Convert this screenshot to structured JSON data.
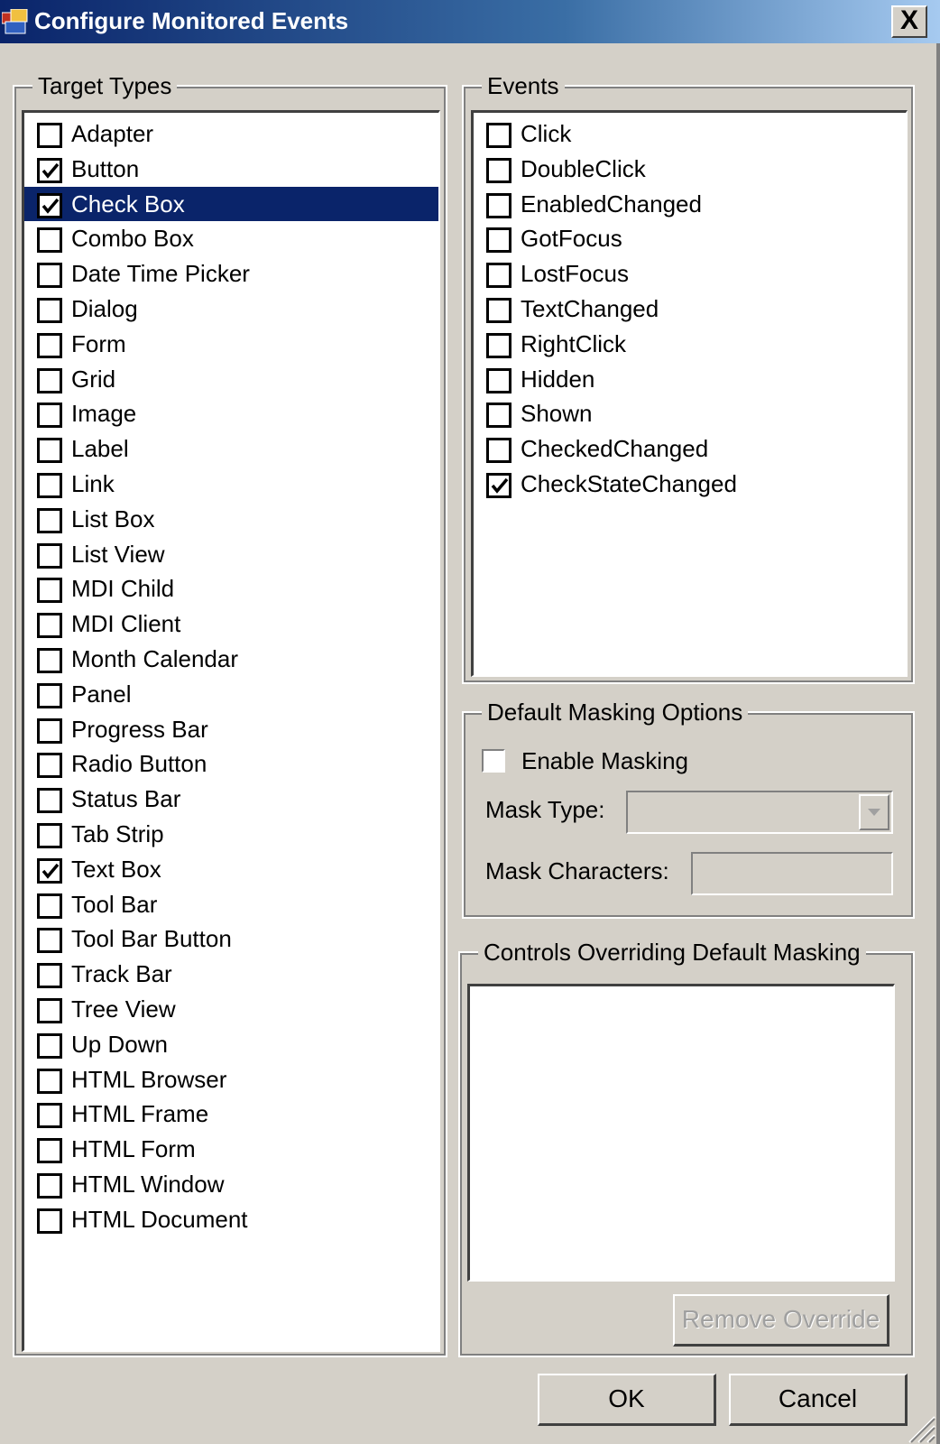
{
  "window": {
    "title": "Configure Monitored Events",
    "close_glyph": "X",
    "icon": "app-window-icon"
  },
  "target_types": {
    "legend": "Target Types",
    "items": [
      {
        "label": "Adapter",
        "checked": false,
        "selected": false
      },
      {
        "label": "Button",
        "checked": true,
        "selected": false
      },
      {
        "label": "Check Box",
        "checked": true,
        "selected": true
      },
      {
        "label": "Combo Box",
        "checked": false,
        "selected": false
      },
      {
        "label": "Date Time Picker",
        "checked": false,
        "selected": false
      },
      {
        "label": "Dialog",
        "checked": false,
        "selected": false
      },
      {
        "label": "Form",
        "checked": false,
        "selected": false
      },
      {
        "label": "Grid",
        "checked": false,
        "selected": false
      },
      {
        "label": "Image",
        "checked": false,
        "selected": false
      },
      {
        "label": "Label",
        "checked": false,
        "selected": false
      },
      {
        "label": "Link",
        "checked": false,
        "selected": false
      },
      {
        "label": "List Box",
        "checked": false,
        "selected": false
      },
      {
        "label": "List View",
        "checked": false,
        "selected": false
      },
      {
        "label": "MDI Child",
        "checked": false,
        "selected": false
      },
      {
        "label": "MDI Client",
        "checked": false,
        "selected": false
      },
      {
        "label": "Month Calendar",
        "checked": false,
        "selected": false
      },
      {
        "label": "Panel",
        "checked": false,
        "selected": false
      },
      {
        "label": "Progress Bar",
        "checked": false,
        "selected": false
      },
      {
        "label": "Radio Button",
        "checked": false,
        "selected": false
      },
      {
        "label": "Status Bar",
        "checked": false,
        "selected": false
      },
      {
        "label": "Tab Strip",
        "checked": false,
        "selected": false
      },
      {
        "label": "Text Box",
        "checked": true,
        "selected": false
      },
      {
        "label": "Tool Bar",
        "checked": false,
        "selected": false
      },
      {
        "label": "Tool Bar Button",
        "checked": false,
        "selected": false
      },
      {
        "label": "Track Bar",
        "checked": false,
        "selected": false
      },
      {
        "label": "Tree View",
        "checked": false,
        "selected": false
      },
      {
        "label": "Up Down",
        "checked": false,
        "selected": false
      },
      {
        "label": "HTML Browser",
        "checked": false,
        "selected": false
      },
      {
        "label": "HTML Frame",
        "checked": false,
        "selected": false
      },
      {
        "label": "HTML Form",
        "checked": false,
        "selected": false
      },
      {
        "label": "HTML Window",
        "checked": false,
        "selected": false
      },
      {
        "label": "HTML Document",
        "checked": false,
        "selected": false
      }
    ]
  },
  "events": {
    "legend": "Events",
    "items": [
      {
        "label": "Click",
        "checked": false
      },
      {
        "label": "DoubleClick",
        "checked": false
      },
      {
        "label": "EnabledChanged",
        "checked": false
      },
      {
        "label": "GotFocus",
        "checked": false
      },
      {
        "label": "LostFocus",
        "checked": false
      },
      {
        "label": "TextChanged",
        "checked": false
      },
      {
        "label": "RightClick",
        "checked": false
      },
      {
        "label": "Hidden",
        "checked": false
      },
      {
        "label": "Shown",
        "checked": false
      },
      {
        "label": "CheckedChanged",
        "checked": false
      },
      {
        "label": "CheckStateChanged",
        "checked": true
      }
    ]
  },
  "masking": {
    "legend": "Default Masking Options",
    "enable_label": "Enable Masking",
    "enable_checked": false,
    "mask_type_label": "Mask Type:",
    "mask_type_value": "",
    "mask_chars_label": "Mask Characters:",
    "mask_chars_value": ""
  },
  "overrides": {
    "legend": "Controls Overriding Default Masking",
    "remove_button": "Remove Override"
  },
  "footer": {
    "ok_label": "OK",
    "cancel_label": "Cancel"
  }
}
